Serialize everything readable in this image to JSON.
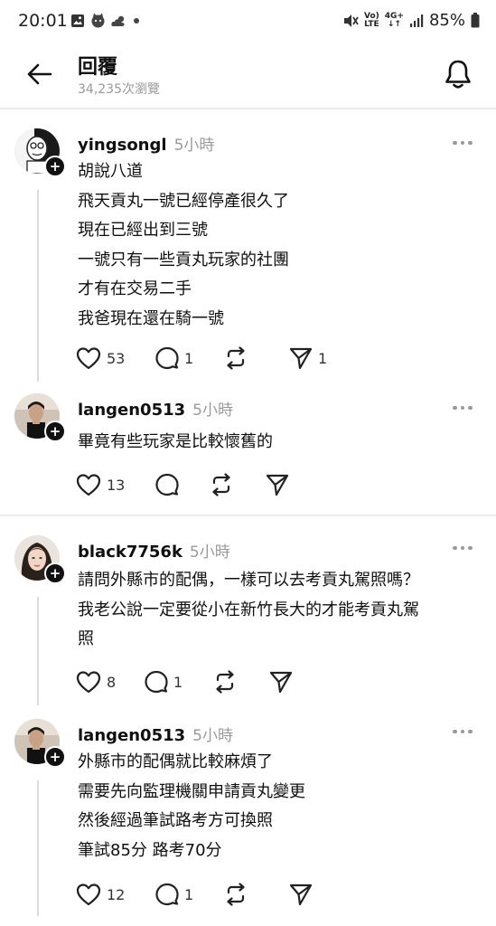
{
  "status_bar": {
    "time": "20:01",
    "battery": "85%",
    "network_small_1": "Vo)",
    "network_small_2": "LTE",
    "network_small_3": "4G+",
    "icons": [
      "gallery-icon",
      "cat-icon",
      "cloud-icon",
      "dot-icon",
      "mute-icon",
      "signal-icon",
      "battery-icon"
    ]
  },
  "header": {
    "title": "回覆",
    "views": "34,235次瀏覽"
  },
  "posts": [
    {
      "username": "yingsongl",
      "time": "5小時",
      "lines": [
        "胡說八道",
        "飛天貢丸一號已經停產很久了",
        "現在已經出到三號",
        "一號只有一些貢丸玩家的社團",
        "才有在交易二手",
        "我爸現在還在騎一號"
      ],
      "likes": "53",
      "comments": "1",
      "reposts": "",
      "shares": "1"
    },
    {
      "username": "langen0513",
      "time": "5小時",
      "lines": [
        "畢竟有些玩家是比較懷舊的"
      ],
      "likes": "13",
      "comments": "",
      "reposts": "",
      "shares": ""
    },
    {
      "username": "black7756k",
      "time": "5小時",
      "lines": [
        "請問外縣市的配偶，一樣可以去考貢丸駕照嗎？",
        "我老公說一定要從小在新竹長大的才能考貢丸駕",
        "照"
      ],
      "likes": "8",
      "comments": "1",
      "reposts": "",
      "shares": ""
    },
    {
      "username": "langen0513",
      "time": "5小時",
      "lines": [
        "外縣市的配偶就比較麻煩了",
        "需要先向監理機關申請貢丸變更",
        "然後經過筆試路考方可換照",
        "筆試85分 路考70分"
      ],
      "likes": "12",
      "comments": "1",
      "reposts": "",
      "shares": ""
    }
  ]
}
